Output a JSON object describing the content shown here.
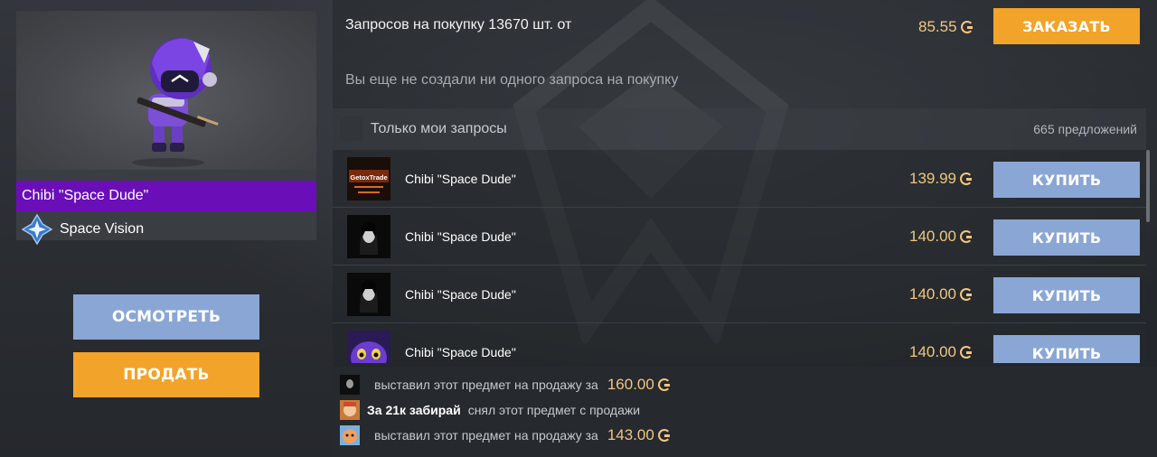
{
  "item": {
    "name": "Chibi \"Space Dude\"",
    "collection": "Space Vision",
    "inspect_label": "ОСМОТРЕТЬ",
    "sell_label": "ПРОДАТЬ"
  },
  "requests": {
    "summary": "Запросов на покупку 13670 шт. от",
    "price": "85.55",
    "order_label": "ЗАКАЗАТЬ",
    "empty_info": "Вы еще не создали ни одного запроса на покупку"
  },
  "filter": {
    "only_mine_label": "Только мои запросы",
    "offers_count": "665 предложений"
  },
  "listings": [
    {
      "seller_avatar": "getoxtrade-avatar",
      "name": "Chibi \"Space Dude\"",
      "price": "139.99",
      "button": "КУПИТЬ"
    },
    {
      "seller_avatar": "dark-portrait-avatar",
      "name": "Chibi \"Space Dude\"",
      "price": "140.00",
      "button": "КУПИТЬ"
    },
    {
      "seller_avatar": "dark-portrait-avatar",
      "name": "Chibi \"Space Dude\"",
      "price": "140.00",
      "button": "КУПИТЬ"
    },
    {
      "seller_avatar": "purple-creature-avatar",
      "name": "Chibi \"Space Dude\"",
      "price": "140.00",
      "button": "КУПИТЬ"
    }
  ],
  "activity": [
    {
      "user": "",
      "action": "выставил этот предмет на продажу за",
      "price": "160.00"
    },
    {
      "user": "За 21к забирай",
      "action": "снял этот предмет с продажи",
      "price": ""
    },
    {
      "user": "",
      "action": "выставил этот предмет на продажу за",
      "price": "143.00"
    }
  ],
  "colors": {
    "accent_orange": "#f2a32a",
    "accent_blue": "#8aa6d4",
    "rarity_purple": "#6a0fb8",
    "gold": "#f0c680"
  },
  "icons": {
    "currency": "gold-g-icon",
    "collection": "star-badge-icon"
  }
}
